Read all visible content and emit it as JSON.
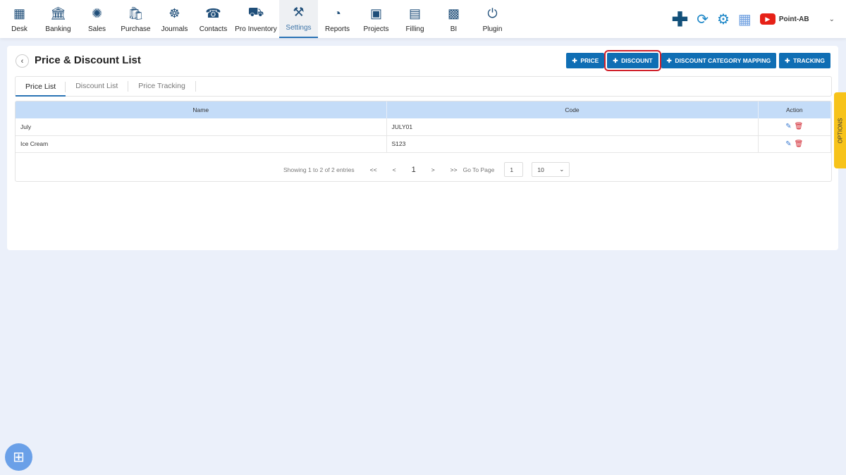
{
  "nav": [
    {
      "label": "Desk",
      "icon": "desk-icon",
      "glyph": "▦"
    },
    {
      "label": "Banking",
      "icon": "bank-icon",
      "glyph": "🏛"
    },
    {
      "label": "Sales",
      "icon": "sales-icon",
      "glyph": "✺"
    },
    {
      "label": "Purchase",
      "icon": "purchase-icon",
      "glyph": "🛍"
    },
    {
      "label": "Journals",
      "icon": "journals-icon",
      "glyph": "☸"
    },
    {
      "label": "Contacts",
      "icon": "contacts-icon",
      "glyph": "☎"
    },
    {
      "label": "Pro Inventory",
      "icon": "inventory-icon",
      "glyph": "⛟"
    },
    {
      "label": "Settings",
      "icon": "settings-icon",
      "glyph": "⚒",
      "active": true
    },
    {
      "label": "Reports",
      "icon": "reports-icon",
      "glyph": "◔"
    },
    {
      "label": "Projects",
      "icon": "projects-icon",
      "glyph": "▣"
    },
    {
      "label": "Filling",
      "icon": "filling-icon",
      "glyph": "▤"
    },
    {
      "label": "BI",
      "icon": "bi-icon",
      "glyph": "▩"
    },
    {
      "label": "Plugin",
      "icon": "plugin-icon",
      "glyph": "⏻"
    }
  ],
  "header": {
    "user": "Point-AB",
    "plus": "✚",
    "sync": "⟳",
    "gear": "⚙",
    "calc": "▦"
  },
  "page": {
    "title": "Price & Discount List",
    "back": "‹"
  },
  "buttons": [
    "PRICE",
    "DISCOUNT",
    "DISCOUNT CATEGORY MAPPING",
    "TRACKING"
  ],
  "tabs": [
    "Price List",
    "Discount List",
    "Price Tracking"
  ],
  "table": {
    "columns": [
      "Name",
      "Code",
      "Action"
    ],
    "rows": [
      [
        "July",
        "JULY01"
      ],
      [
        "Ice Cream",
        "S123"
      ]
    ]
  },
  "pager": {
    "info": "Showing 1 to 2 of 2 entries",
    "first": "<<",
    "prev": "<",
    "current": "1",
    "next": ">",
    "last": ">>",
    "goto_label": "Go To Page",
    "goto_value": "1",
    "page_size": "10"
  },
  "options_label": "OPTIONS",
  "colors": {
    "primary": "#0f6eb4",
    "highlight": "#d0202a",
    "options": "#f7c31a"
  }
}
